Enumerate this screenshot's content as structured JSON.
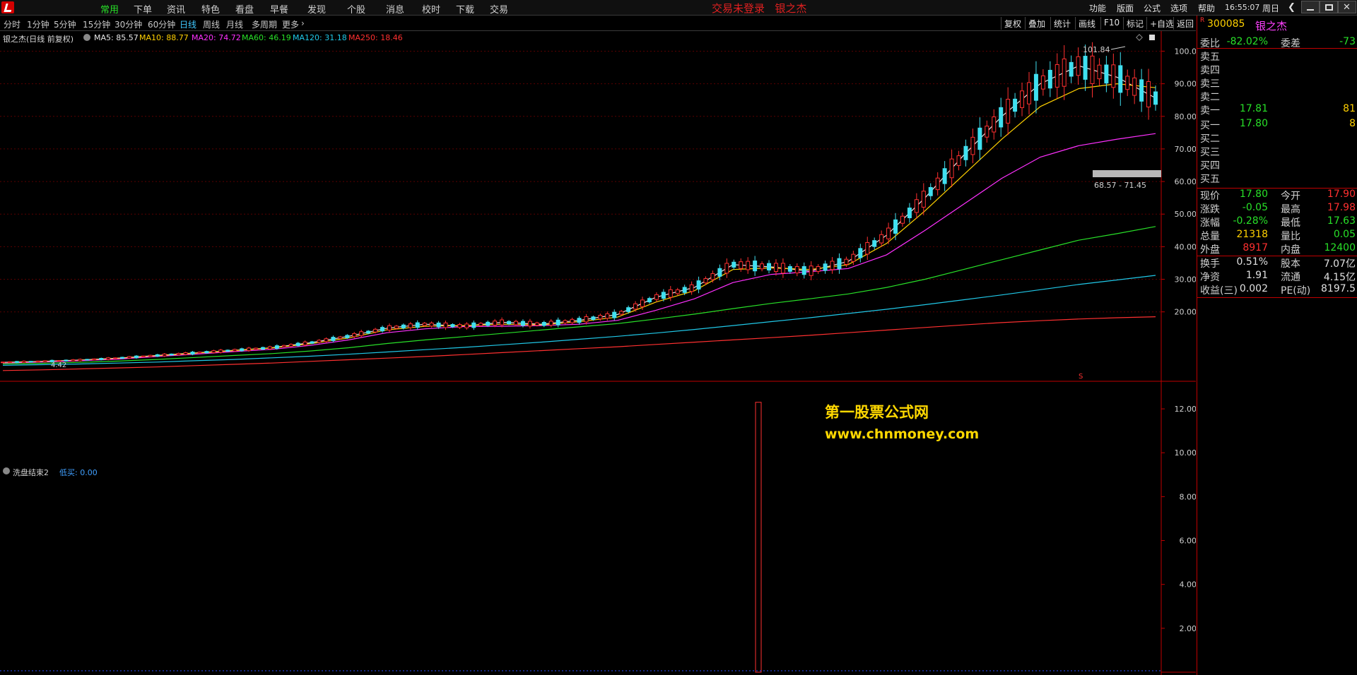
{
  "menu": {
    "items": [
      "常用",
      "下单",
      "资讯",
      "特色",
      "看盘",
      "早餐",
      "发现",
      "个股",
      "消息",
      "校时",
      "下载",
      "交易"
    ],
    "active": "常用",
    "login_status": "交易未登录",
    "stock_name_title": "银之杰",
    "sys_items": [
      "功能",
      "版面",
      "公式",
      "选项",
      "帮助"
    ],
    "clock": "16:55:07",
    "weekday": "周日"
  },
  "periods": {
    "items": [
      "分时",
      "1分钟",
      "5分钟",
      "15分钟",
      "30分钟",
      "60分钟",
      "日线",
      "周线",
      "月线",
      "多周期",
      "更多"
    ],
    "active": "日线",
    "tools": [
      "复权",
      "叠加",
      "统计",
      "画线",
      "F10",
      "标记",
      "+自选",
      "返回"
    ]
  },
  "legend": {
    "title": "银之杰(日线 前复权)",
    "ma": [
      {
        "label": "MA5: 85.57",
        "color": "#e8e8e8"
      },
      {
        "label": "MA10: 88.77",
        "color": "#ffd000"
      },
      {
        "label": "MA20: 74.72",
        "color": "#ff30ff"
      },
      {
        "label": "MA60: 46.19",
        "color": "#28e028"
      },
      {
        "label": "MA120: 31.18",
        "color": "#20c8e8"
      },
      {
        "label": "MA250: 18.46",
        "color": "#ff3030"
      }
    ]
  },
  "annotations": {
    "high_label": "101.84",
    "low_label": "4.42",
    "range_label": "68.57 - 71.45",
    "s_mark": "S"
  },
  "indicator": {
    "name": "洗盘结束2",
    "value": "低买: 0.00"
  },
  "watermark": {
    "line1": "第一股票公式网",
    "line2": "www.chnmoney.com"
  },
  "chart_data": [
    {
      "type": "line",
      "title": "银之杰(日线 前复权)",
      "ylim": [
        0,
        104
      ],
      "y_ticks": [
        "100.0",
        "90.00",
        "80.00",
        "70.00",
        "60.00",
        "50.00",
        "40.00",
        "30.00",
        "20.00"
      ],
      "series": [
        {
          "name": "MA5",
          "values": [
            4.5,
            4.8,
            5.2,
            5.8,
            6.6,
            7.4,
            8.2,
            9.0,
            10.5,
            12.5,
            15.0,
            16.2,
            15.6,
            16.8,
            16.2,
            17.4,
            19.2,
            24.5,
            27.5,
            34.5,
            33.8,
            32.5,
            35.5,
            43.5,
            55.0,
            68.0,
            80.0,
            90.0,
            95.5,
            92.0,
            85.6
          ],
          "color": "#e8e8e8"
        },
        {
          "name": "MA10",
          "values": [
            4.4,
            4.7,
            5.1,
            5.7,
            6.5,
            7.3,
            8.1,
            8.9,
            10.2,
            12.0,
            14.5,
            15.6,
            15.8,
            16.2,
            16.0,
            17.0,
            18.4,
            23.0,
            26.5,
            33.0,
            33.5,
            33.0,
            34.5,
            41.0,
            51.0,
            62.0,
            73.0,
            83.0,
            88.5,
            90.0,
            88.8
          ],
          "color": "#ffd000"
        },
        {
          "name": "MA20",
          "values": [
            4.3,
            4.6,
            5.0,
            5.5,
            6.3,
            7.0,
            7.8,
            8.5,
            9.7,
            11.4,
            13.6,
            14.8,
            15.5,
            15.6,
            15.8,
            16.2,
            17.4,
            20.5,
            24.0,
            29.0,
            31.5,
            32.3,
            33.3,
            37.5,
            45.0,
            53.0,
            61.0,
            67.5,
            71.0,
            73.0,
            74.7
          ],
          "color": "#ff30ff"
        },
        {
          "name": "MA60",
          "values": [
            4.0,
            4.2,
            4.5,
            4.9,
            5.4,
            6.0,
            6.6,
            7.2,
            8.0,
            9.0,
            10.3,
            11.4,
            12.4,
            13.4,
            14.4,
            15.4,
            16.4,
            17.8,
            19.3,
            21.0,
            22.6,
            24.0,
            25.5,
            27.5,
            30.0,
            33.0,
            36.0,
            39.0,
            42.0,
            44.0,
            46.2
          ],
          "color": "#28e028"
        },
        {
          "name": "MA120",
          "values": [
            3.6,
            3.8,
            4.0,
            4.3,
            4.6,
            5.0,
            5.4,
            5.9,
            6.4,
            7.0,
            7.7,
            8.4,
            9.1,
            9.9,
            10.7,
            11.6,
            12.5,
            13.5,
            14.6,
            15.8,
            17.0,
            18.2,
            19.5,
            20.8,
            22.2,
            23.7,
            25.2,
            26.8,
            28.4,
            29.8,
            31.2
          ],
          "color": "#20c8e8"
        },
        {
          "name": "MA250",
          "values": [
            2.0,
            2.2,
            2.5,
            2.8,
            3.1,
            3.5,
            3.9,
            4.3,
            4.8,
            5.3,
            5.8,
            6.3,
            6.9,
            7.5,
            8.1,
            8.7,
            9.3,
            10.0,
            10.7,
            11.4,
            12.1,
            12.8,
            13.6,
            14.4,
            15.2,
            16.0,
            16.7,
            17.3,
            17.8,
            18.2,
            18.5
          ],
          "color": "#ff3030"
        }
      ]
    },
    {
      "type": "bar",
      "title": "洗盘结束2",
      "ylim": [
        0,
        13
      ],
      "y_ticks": [
        "12.00",
        "10.00",
        "8.00",
        "6.00",
        "4.00",
        "2.00"
      ],
      "series": [
        {
          "name": "低买",
          "values": [
            0,
            12.3,
            0
          ]
        }
      ]
    }
  ],
  "quote": {
    "code": "300085",
    "name": "银之杰",
    "rows": [
      {
        "l": "委比",
        "v": "-82.02%",
        "vc": "g",
        "l2": "委差",
        "v2": "-73",
        "v2c": "g"
      },
      {
        "l": "卖五",
        "v": "",
        "vc": "w",
        "l2": "",
        "v2": "",
        "v2c": "w"
      },
      {
        "l": "卖四",
        "v": "",
        "vc": "w",
        "l2": "",
        "v2": "",
        "v2c": "w"
      },
      {
        "l": "卖三",
        "v": "",
        "vc": "w",
        "l2": "",
        "v2": "",
        "v2c": "w"
      },
      {
        "l": "卖二",
        "v": "",
        "vc": "w",
        "l2": "",
        "v2": "",
        "v2c": "w"
      },
      {
        "l": "卖一",
        "v": "17.81",
        "vc": "g",
        "l2": "",
        "v2": "81",
        "v2c": "y"
      },
      {
        "l": "买一",
        "v": "17.80",
        "vc": "g",
        "l2": "",
        "v2": "8",
        "v2c": "y"
      },
      {
        "l": "买二",
        "v": "",
        "vc": "w",
        "l2": "",
        "v2": "",
        "v2c": "w"
      },
      {
        "l": "买三",
        "v": "",
        "vc": "w",
        "l2": "",
        "v2": "",
        "v2c": "w"
      },
      {
        "l": "买四",
        "v": "",
        "vc": "w",
        "l2": "",
        "v2": "",
        "v2c": "w"
      },
      {
        "l": "买五",
        "v": "",
        "vc": "w",
        "l2": "",
        "v2": "",
        "v2c": "w"
      },
      {
        "l": "现价",
        "v": "17.80",
        "vc": "g",
        "l2": "今开",
        "v2": "17.90",
        "v2c": "r"
      },
      {
        "l": "涨跌",
        "v": "-0.05",
        "vc": "g",
        "l2": "最高",
        "v2": "17.98",
        "v2c": "r"
      },
      {
        "l": "涨幅",
        "v": "-0.28%",
        "vc": "g",
        "l2": "最低",
        "v2": "17.63",
        "v2c": "g"
      },
      {
        "l": "总量",
        "v": "21318",
        "vc": "y",
        "l2": "量比",
        "v2": "0.05",
        "v2c": "g"
      },
      {
        "l": "外盘",
        "v": "8917",
        "vc": "r",
        "l2": "内盘",
        "v2": "12400",
        "v2c": "g"
      },
      {
        "l": "换手",
        "v": "0.51%",
        "vc": "w",
        "l2": "股本",
        "v2": "7.07亿",
        "v2c": "w"
      },
      {
        "l": "净资",
        "v": "1.91",
        "vc": "w",
        "l2": "流通",
        "v2": "4.15亿",
        "v2c": "w"
      },
      {
        "l": "收益(三)",
        "v": "0.002",
        "vc": "w",
        "l2": "PE(动)",
        "v2": "8197.5",
        "v2c": "w"
      }
    ]
  }
}
